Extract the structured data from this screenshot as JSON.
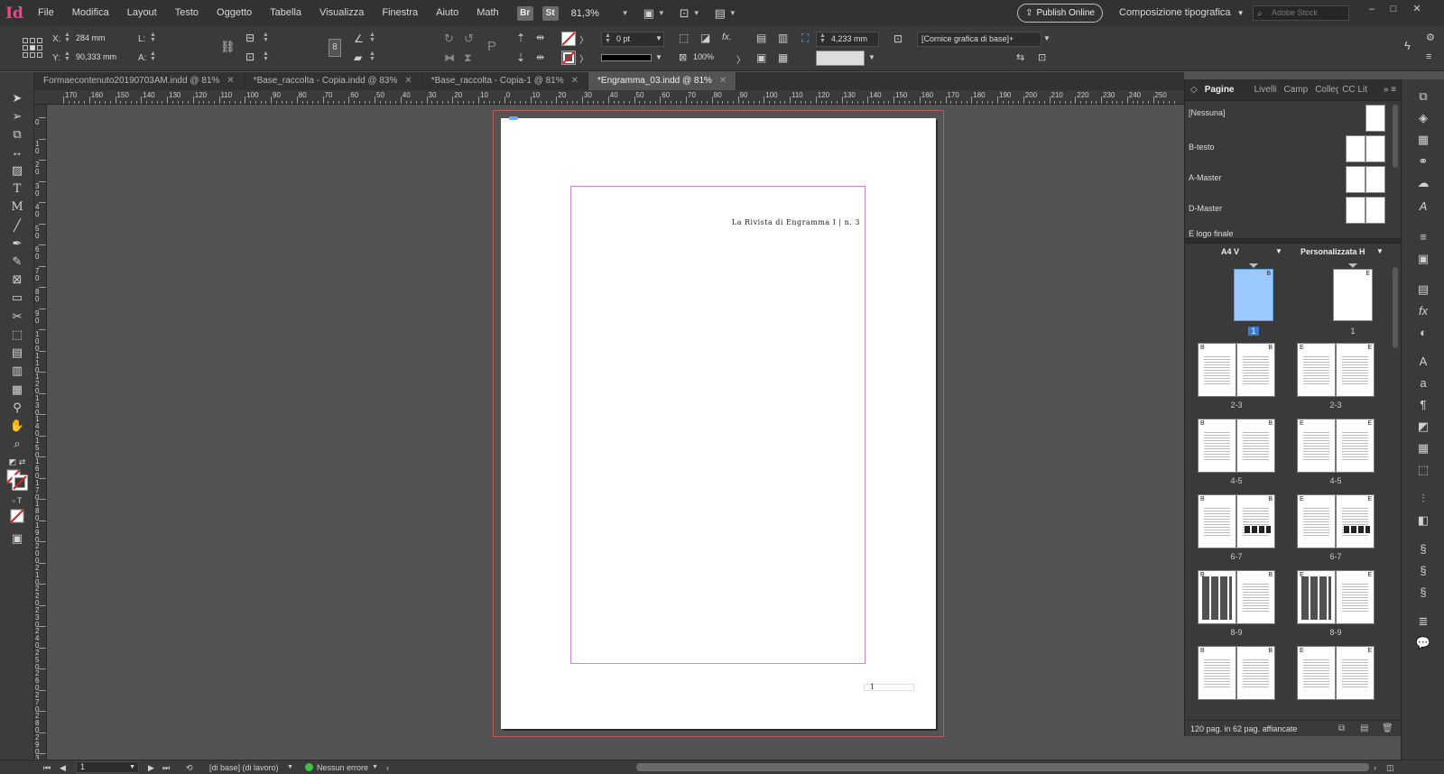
{
  "app": {
    "logo": "Id"
  },
  "menu": [
    "File",
    "Modifica",
    "Layout",
    "Testo",
    "Oggetto",
    "Tabella",
    "Visualizza",
    "Finestra",
    "Aiuto",
    "Math"
  ],
  "appbar": {
    "bridge": "Br",
    "stock": "St",
    "zoom": "81,3%",
    "publish_label": "Publish Online",
    "workspace": "Composizione tipografica",
    "search_placeholder": "Adobe Stock"
  },
  "control": {
    "x_label": "X:",
    "x_value": "284 mm",
    "y_label": "Y:",
    "y_value": "90,333 mm",
    "w_label": "L:",
    "h_label": "A:",
    "stroke_weight": "0 pt",
    "opacity": "100%",
    "dimension": "4,233 mm",
    "object_style": "[Cornice grafica di base]+",
    "fx": "fx."
  },
  "tabs": [
    {
      "label": "Formaecontenuto20190703AM.indd @ 81%",
      "active": false
    },
    {
      "label": "*Base_raccolta - Copia.indd @ 83%",
      "active": false
    },
    {
      "label": "*Base_raccolta - Copia-1 @ 81%",
      "active": false
    },
    {
      "label": "*Engramma_03.indd @ 81%",
      "active": true
    }
  ],
  "ruler_h": [
    "170",
    "160",
    "150",
    "140",
    "130",
    "120",
    "110",
    "100",
    "90",
    "80",
    "70",
    "60",
    "50",
    "40",
    "30",
    "20",
    "10",
    "0",
    "10",
    "20",
    "30",
    "40",
    "50",
    "60",
    "70",
    "80",
    "90",
    "100",
    "110",
    "120",
    "130",
    "140",
    "150",
    "160",
    "170",
    "180",
    "190",
    "200",
    "210",
    "220",
    "230",
    "240",
    "250"
  ],
  "ruler_v": [
    "0",
    "10",
    "20",
    "30",
    "40",
    "50",
    "60",
    "70",
    "80",
    "90",
    "100",
    "110",
    "120",
    "130",
    "140",
    "150",
    "160",
    "170",
    "180",
    "190",
    "200",
    "210",
    "220",
    "230",
    "240",
    "250",
    "260",
    "270",
    "280",
    "290",
    "300"
  ],
  "document": {
    "running_head": "La Rivista di Engramma I | n. 3",
    "page_number": "1"
  },
  "panel": {
    "tabs": [
      "Pagine",
      "Livelli",
      "Camp",
      "Colleg",
      "CC Lit"
    ],
    "masters": [
      "[Nessuna]",
      "B-testo",
      "A-Master",
      "D-Master",
      "E logo finale"
    ],
    "col_left": "A4 V",
    "col_right": "Personalizzata H",
    "first_left": {
      "tag": "B",
      "label": "1"
    },
    "first_right": {
      "tag": "E",
      "label": "1"
    },
    "spreads": [
      {
        "label": "2-3",
        "kind": "text"
      },
      {
        "label": "4-5",
        "kind": "text"
      },
      {
        "label": "6-7",
        "kind": "strip"
      },
      {
        "label": "8-9",
        "kind": "images"
      },
      {
        "label": "",
        "kind": "text"
      }
    ],
    "footer": "120 pag. in 62 pag. affiancate"
  },
  "status": {
    "page": "1",
    "master_state": "[di base] (di lavoro)",
    "preflight": "Nessun errore"
  },
  "colors": {
    "accent": "#ff3e8f",
    "selection": "#9cc9ff",
    "margin": "#d383d3",
    "bleed": "#b85c5c",
    "ok": "#3ec43e"
  }
}
